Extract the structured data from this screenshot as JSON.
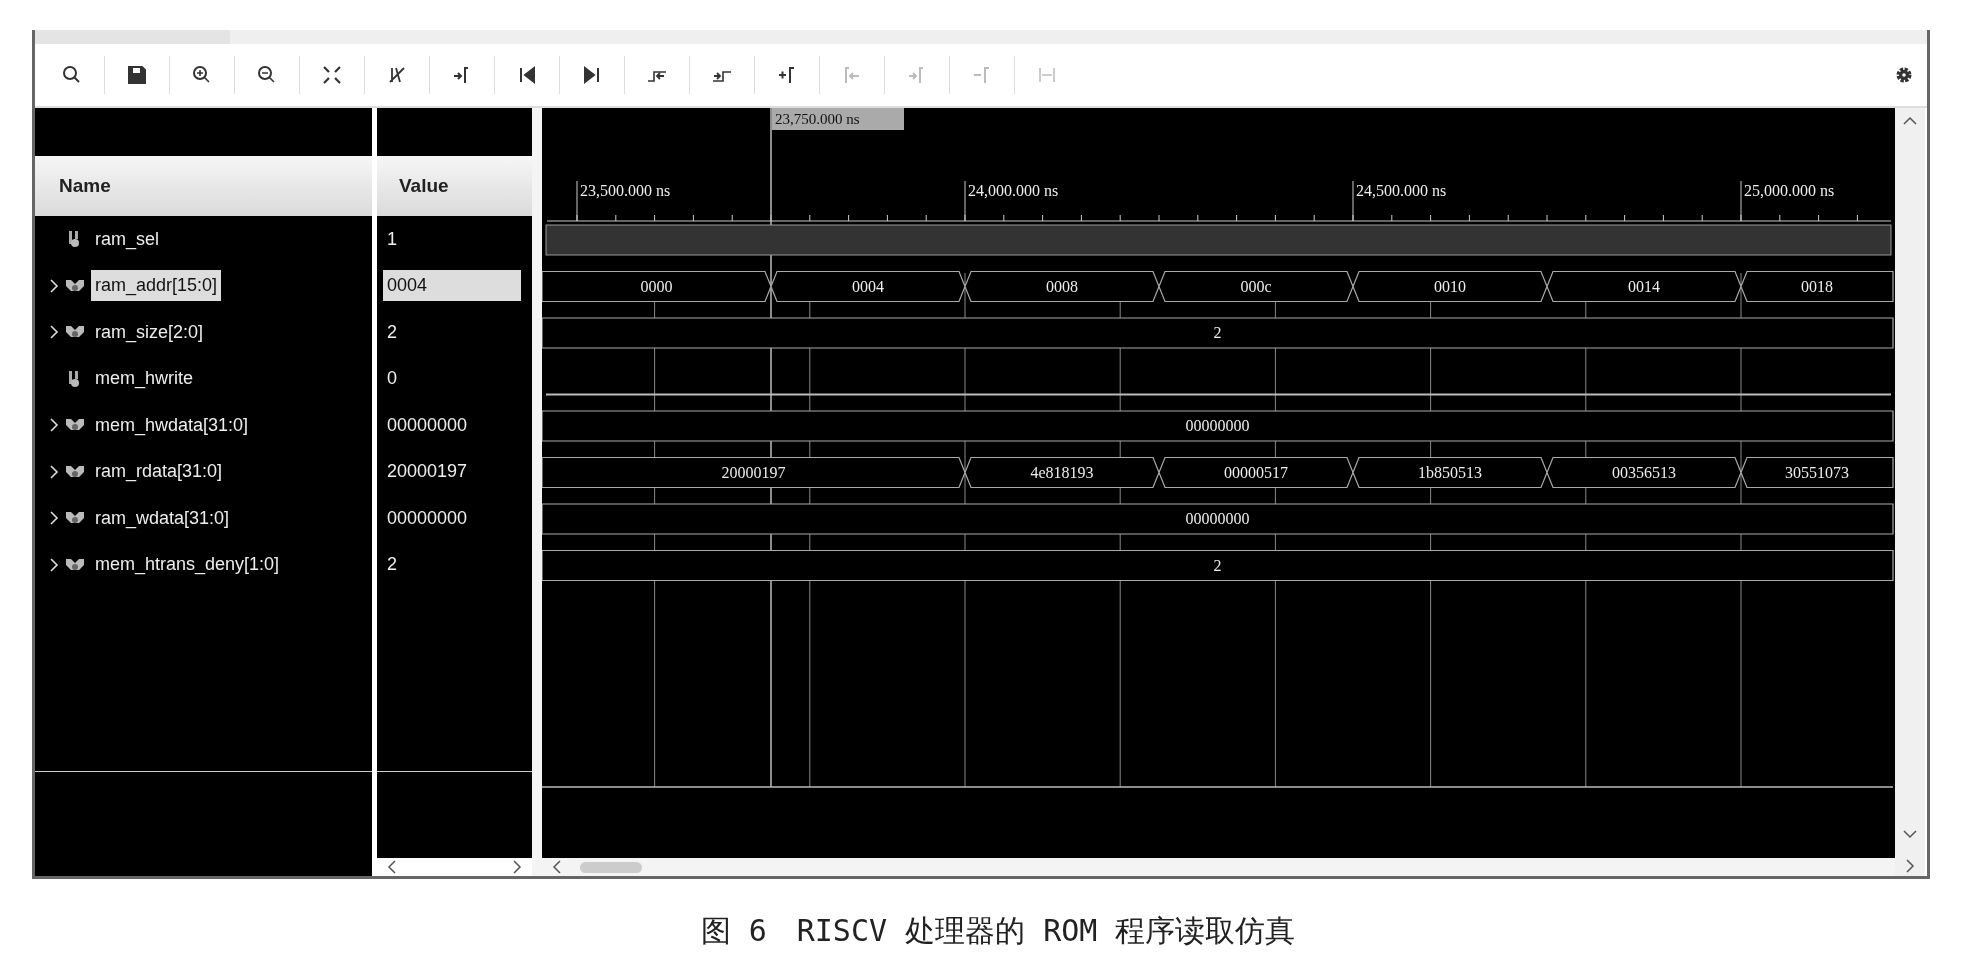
{
  "toolbar": {
    "buttons": [
      {
        "kind": "search",
        "disabled": false
      },
      {
        "kind": "save",
        "disabled": false
      },
      {
        "kind": "zoom-in",
        "disabled": false
      },
      {
        "kind": "zoom-out",
        "disabled": false
      },
      {
        "kind": "zoom-fit",
        "disabled": false
      },
      {
        "kind": "cursor-off",
        "disabled": false
      },
      {
        "kind": "snap",
        "disabled": false
      },
      {
        "kind": "first",
        "disabled": false
      },
      {
        "kind": "last",
        "disabled": false
      },
      {
        "kind": "prev-edge",
        "disabled": false
      },
      {
        "kind": "next-edge",
        "disabled": false
      },
      {
        "kind": "add-marker",
        "disabled": false
      },
      {
        "kind": "prev-marker",
        "disabled": true
      },
      {
        "kind": "next-marker",
        "disabled": true
      },
      {
        "kind": "remove-marker",
        "disabled": true
      },
      {
        "kind": "measure",
        "disabled": true
      },
      {
        "kind": "settings",
        "disabled": false
      }
    ]
  },
  "columns": {
    "name": "Name",
    "value": "Value"
  },
  "signals": [
    {
      "name": "ram_sel",
      "value": "1",
      "kind": "bit",
      "expandable": false,
      "selected": false,
      "high": true
    },
    {
      "name": "ram_addr[15:0]",
      "value": "0004",
      "kind": "bus",
      "expandable": true,
      "selected": true,
      "segments": [
        {
          "value": "0000"
        },
        {
          "value": "0004"
        },
        {
          "value": "0008"
        },
        {
          "value": "000c"
        },
        {
          "value": "0010"
        },
        {
          "value": "0014"
        },
        {
          "value": "0018"
        }
      ]
    },
    {
      "name": "ram_size[2:0]",
      "value": "2",
      "kind": "bus",
      "expandable": true,
      "selected": false,
      "segments": [
        {
          "value": "2"
        }
      ]
    },
    {
      "name": "mem_hwrite",
      "value": "0",
      "kind": "bit",
      "expandable": false,
      "selected": false,
      "high": false
    },
    {
      "name": "mem_hwdata[31:0]",
      "value": "00000000",
      "kind": "bus",
      "expandable": true,
      "selected": false,
      "segments": [
        {
          "value": "00000000"
        }
      ]
    },
    {
      "name": "ram_rdata[31:0]",
      "value": "20000197",
      "kind": "bus",
      "expandable": true,
      "selected": false,
      "segments": [
        {
          "value": "20000197"
        },
        {
          "value": "4e818193"
        },
        {
          "value": "00000517"
        },
        {
          "value": "1b850513"
        },
        {
          "value": "00356513"
        },
        {
          "value": "30551073"
        }
      ]
    },
    {
      "name": "ram_wdata[31:0]",
      "value": "00000000",
      "kind": "bus",
      "expandable": true,
      "selected": false,
      "segments": [
        {
          "value": "00000000"
        }
      ]
    },
    {
      "name": "mem_htrans_deny[1:0]",
      "value": "2",
      "kind": "bus",
      "expandable": true,
      "selected": false,
      "segments": [
        {
          "value": "2"
        }
      ]
    }
  ],
  "waveform": {
    "cursor": {
      "label": "23,750.000 ns"
    },
    "ruler": [
      {
        "label": "23,500.000 ns"
      },
      {
        "label": "24,000.000 ns"
      },
      {
        "label": "24,500.000 ns"
      },
      {
        "label": "25,000.000 ns"
      }
    ]
  },
  "caption": "图 6　RISCV 处理器的 ROM 程序读取仿真"
}
